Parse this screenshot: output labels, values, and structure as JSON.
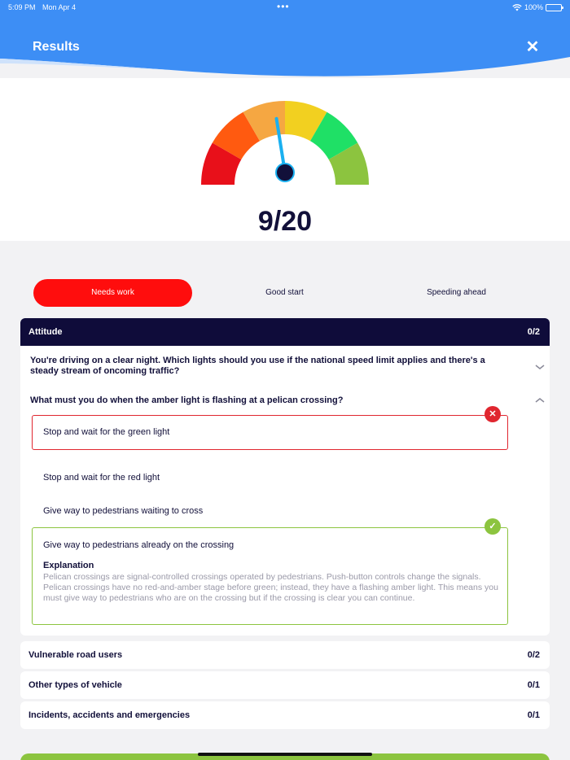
{
  "status": {
    "time": "5:09 PM",
    "date": "Mon Apr 4",
    "dots": "•••",
    "battery": "100%"
  },
  "header": {
    "title": "Results",
    "close_icon": "close-icon"
  },
  "score": {
    "text": "9/20",
    "value": 9,
    "max": 20
  },
  "gauge": {
    "colors": [
      "#e8101a",
      "#ff5a10",
      "#f5a742",
      "#f2d020",
      "#1fe066",
      "#8cc43f"
    ],
    "needle_color": "#1ab0f0"
  },
  "tabs": [
    {
      "label": "Needs work",
      "active": true
    },
    {
      "label": "Good start",
      "active": false
    },
    {
      "label": "Speeding ahead",
      "active": false
    }
  ],
  "sections": {
    "attitude": {
      "label": "Attitude",
      "score": "0/2"
    },
    "vulnerable": {
      "label": "Vulnerable road users",
      "score": "0/2"
    },
    "other": {
      "label": "Other types of vehicle",
      "score": "0/1"
    },
    "incidents": {
      "label": "Incidents, accidents and emergencies",
      "score": "0/1"
    }
  },
  "questions": {
    "q1": "You're driving on a clear night. Which lights should you use if the national speed limit applies and there's a steady stream of oncoming traffic?",
    "q2": "What must you do when the amber light is flashing at a pelican crossing?"
  },
  "options": {
    "o1": "Stop and wait for the green light",
    "o2": "Stop and wait for the red light",
    "o3": "Give way to pedestrians waiting to cross",
    "o4": "Give way to pedestrians already on the crossing"
  },
  "explanation": {
    "title": "Explanation",
    "text": "Pelican crossings are signal-controlled crossings operated by pedestrians. Push-button controls change the signals. Pelican crossings have no red-and-amber stage before green; instead, they have a flashing amber light. This means you must give way to pedestrians who are on the crossing but if the crossing is clear you can continue."
  },
  "colors": {
    "header": "#3d8ef5",
    "wrong": "#e0262f",
    "correct": "#8cc43f",
    "dark": "#0f0c3a",
    "active_tab": "#ff0d0d"
  }
}
